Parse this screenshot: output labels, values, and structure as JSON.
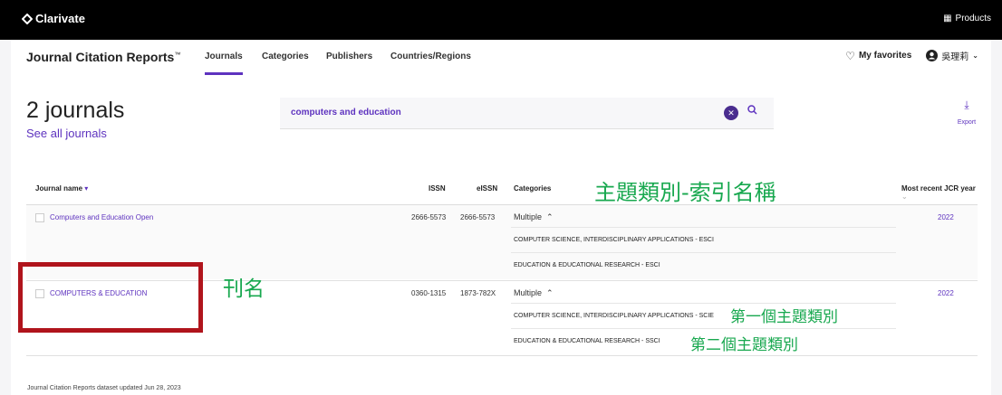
{
  "topbar": {
    "brand": "Clarivate",
    "products": "Products"
  },
  "nav": {
    "app_title": "Journal Citation Reports",
    "trademark": "™",
    "items": [
      "Journals",
      "Categories",
      "Publishers",
      "Countries/Regions"
    ],
    "favorites": "My favorites",
    "user": "吳理莉"
  },
  "results": {
    "count": "2 journals",
    "see_all": "See all journals",
    "search_value": "computers and education",
    "export": "Export"
  },
  "table": {
    "headers": [
      "Journal name",
      "ISSN",
      "eISSN",
      "Categories",
      "Most recent JCR year"
    ],
    "rows": [
      {
        "name": "Computers and Education Open",
        "issn": "2666-5573",
        "eissn": "2666-5573",
        "categories_label": "Multiple",
        "categories": [
          "COMPUTER SCIENCE, INTERDISCIPLINARY APPLICATIONS - ESCI",
          "EDUCATION & EDUCATIONAL RESEARCH - ESCI"
        ],
        "year": "2022"
      },
      {
        "name": "COMPUTERS & EDUCATION",
        "issn": "0360-1315",
        "eissn": "1873-782X",
        "categories_label": "Multiple",
        "categories": [
          "COMPUTER SCIENCE, INTERDISCIPLINARY APPLICATIONS - SCIE",
          "EDUCATION & EDUCATIONAL RESEARCH - SSCI"
        ],
        "year": "2022"
      }
    ]
  },
  "footer": "Journal Citation Reports dataset updated Jun 28, 2023",
  "annotations": {
    "categories_note": "主題類別-索引名稱",
    "title_note": "刊名",
    "first_category": "第一個主題類別",
    "second_category": "第二個主題類別"
  },
  "colors": {
    "accent": "#5e33bf",
    "annotation": "#18a84f",
    "highlight_box": "#b0141c"
  }
}
